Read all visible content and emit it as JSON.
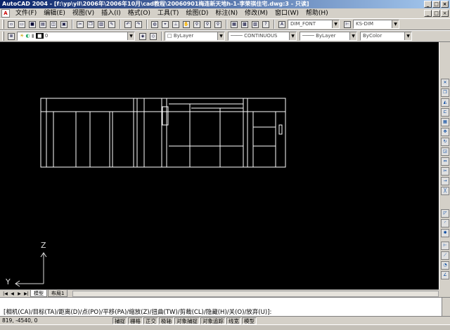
{
  "window": {
    "title": "AutoCAD 2004 - [f:\\yp\\yil\\2006年\\2006年10月\\cad教程\\20060901梅连新天地h-1-李荣祺住宅.dwg:3 - 只读]"
  },
  "menu": [
    "文件(F)",
    "编辑(E)",
    "视图(V)",
    "插入(I)",
    "格式(O)",
    "工具(T)",
    "绘图(D)",
    "标注(N)",
    "修改(M)",
    "窗口(W)",
    "帮助(H)"
  ],
  "toolbar": {
    "text_style": "DIM_FONT",
    "dim_style": "KS-DIM",
    "layer": "0",
    "color": "ByLayer",
    "linetype": "CONTINUOUS",
    "lineweight": "ByLayer",
    "plot_style": "ByColor"
  },
  "tabs": [
    "模型",
    "布局1"
  ],
  "ucs": {
    "z_label": "Z",
    "y_label": "Y"
  },
  "command": {
    "line": "[相机(CA)/目标(TA)/距离(D)/点(PO)/平移(PA)/缩放(Z)/扭曲(TW)/剪裁(CL)/隐藏(H)/关(O)/放弃(U)]:"
  },
  "status": {
    "coords": "819,  -4540, 0",
    "toggles": [
      "捕捉",
      "栅格",
      "正交",
      "极轴",
      "对象捕捉",
      "对象追踪",
      "线宽",
      "模型"
    ]
  },
  "colors": {
    "canvas": "#000000",
    "lines": "#ffffff",
    "titlebar": "#0a246a"
  }
}
